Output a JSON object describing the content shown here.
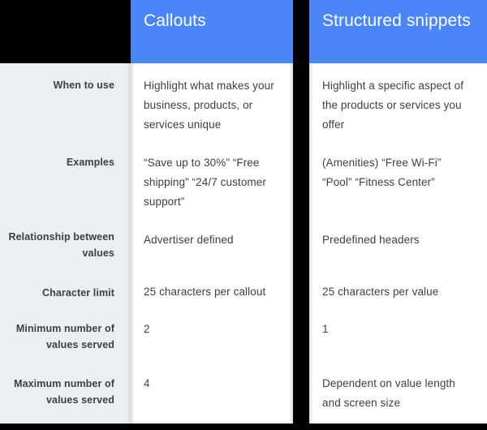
{
  "table": {
    "label_column_header": "",
    "columns": [
      {
        "name": "callouts",
        "header": "Callouts",
        "header_color": "#4a86f7"
      },
      {
        "name": "structured-snippets",
        "header": "Structured snippets",
        "header_color": "#4a86f7"
      }
    ],
    "rows": [
      {
        "name": "when-to-use",
        "label": "When to use",
        "callouts": "Highlight what makes your business, products, or services unique",
        "structured_snippets": "Highlight a specific aspect of the products or services you offer"
      },
      {
        "name": "examples",
        "label": "Examples",
        "callouts": "“Save up to 30%” “Free shipping” “24/7 customer support”",
        "structured_snippets": "(Amenities) “Free Wi-Fi” “Pool” “Fitness Center”"
      },
      {
        "name": "relationship-between-values",
        "label": "Relationship between values",
        "callouts": "Advertiser defined",
        "structured_snippets": "Predefined headers"
      },
      {
        "name": "character-limit",
        "label": "Character limit",
        "callouts": "25 characters per callout",
        "structured_snippets": "25 characters per value"
      },
      {
        "name": "minimum-number-of-values-served",
        "label": "Minimum number of values served",
        "callouts": "2",
        "structured_snippets": "1"
      },
      {
        "name": "maximum-number-of-values-served",
        "label": "Maximum number of values served",
        "callouts": "4",
        "structured_snippets": "Dependent on value length and screen size"
      }
    ]
  },
  "colors": {
    "header_blue": "#4a86f7",
    "label_column_bg": "#eceff1",
    "data_column_bg": "#ffffff",
    "page_bg": "#000000",
    "text": "#3c4043",
    "header_text": "#ffffff"
  }
}
